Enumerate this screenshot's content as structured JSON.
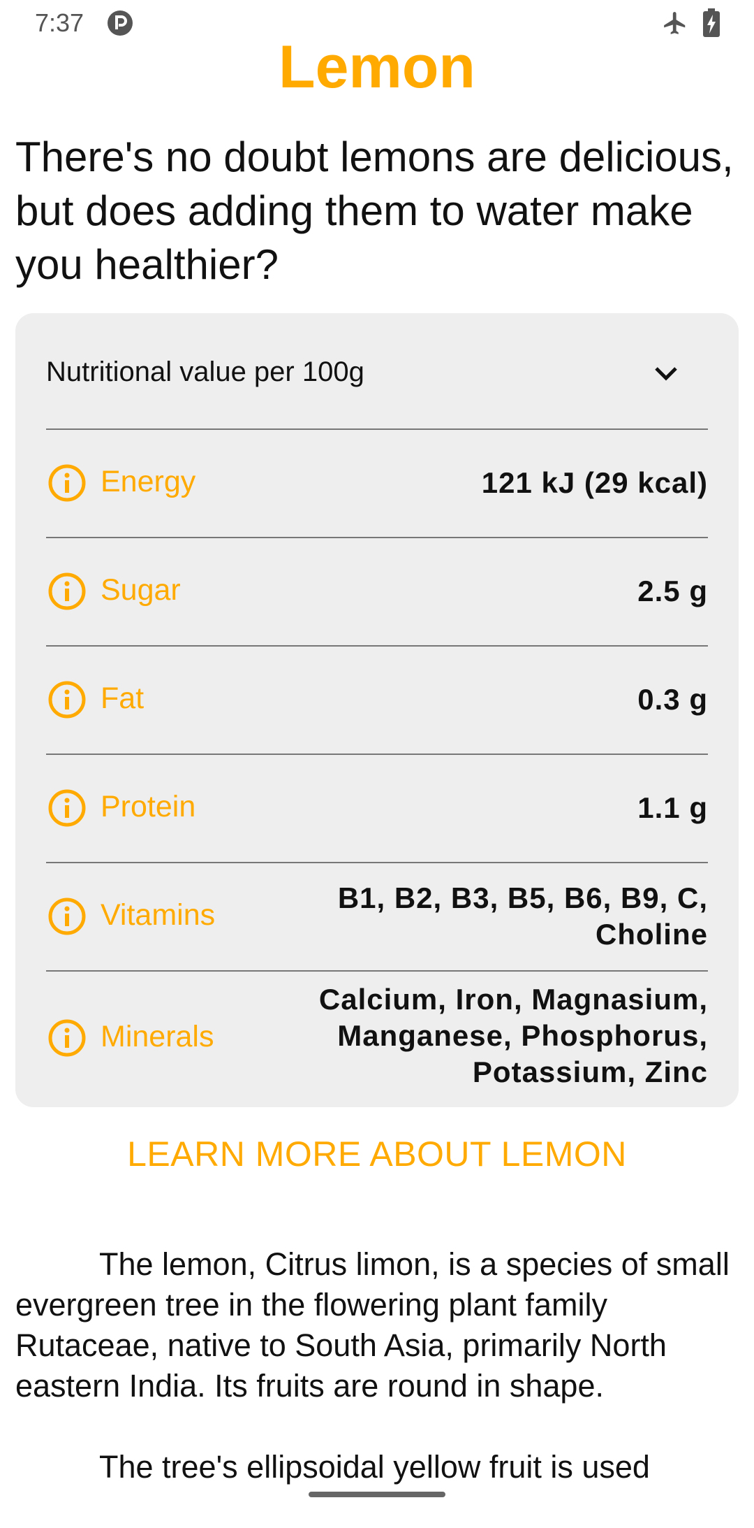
{
  "status_bar": {
    "time": "7:37",
    "icons": [
      "p-badge-icon",
      "airplane-icon",
      "battery-charging-icon"
    ]
  },
  "title": "Lemon",
  "headline": "There's no doubt lemons are delicious, but does adding them to water make you healthier?",
  "nutrition": {
    "header": "Nutritional value per 100g",
    "rows": [
      {
        "label": "Energy",
        "value": "121 kJ (29 kcal)"
      },
      {
        "label": "Sugar",
        "value": "2.5 g"
      },
      {
        "label": "Fat",
        "value": "0.3 g"
      },
      {
        "label": "Protein",
        "value": "1.1 g"
      },
      {
        "label": "Vitamins",
        "value_lines": [
          "B1, B2, B3, B5, B6, B9, C,",
          "Choline"
        ]
      },
      {
        "label": "Minerals",
        "value_lines": [
          "Calcium, Iron, Magnasium,",
          "Manganese, Phosphorus,",
          "Potassium, Zinc"
        ]
      }
    ]
  },
  "learn_more": "LEARN MORE ABOUT LEMON",
  "description": {
    "paragraph1": "The lemon, Citrus limon, is a species of small evergreen tree in the flowering plant family Rutaceae, native to South Asia, primarily North eastern India. Its fruits are round in shape.",
    "paragraph2": "The tree's ellipsoidal yellow fruit is used"
  },
  "colors": {
    "accent": "#FFAA00",
    "card_background": "#EEEEEE",
    "divider": "#777777"
  }
}
